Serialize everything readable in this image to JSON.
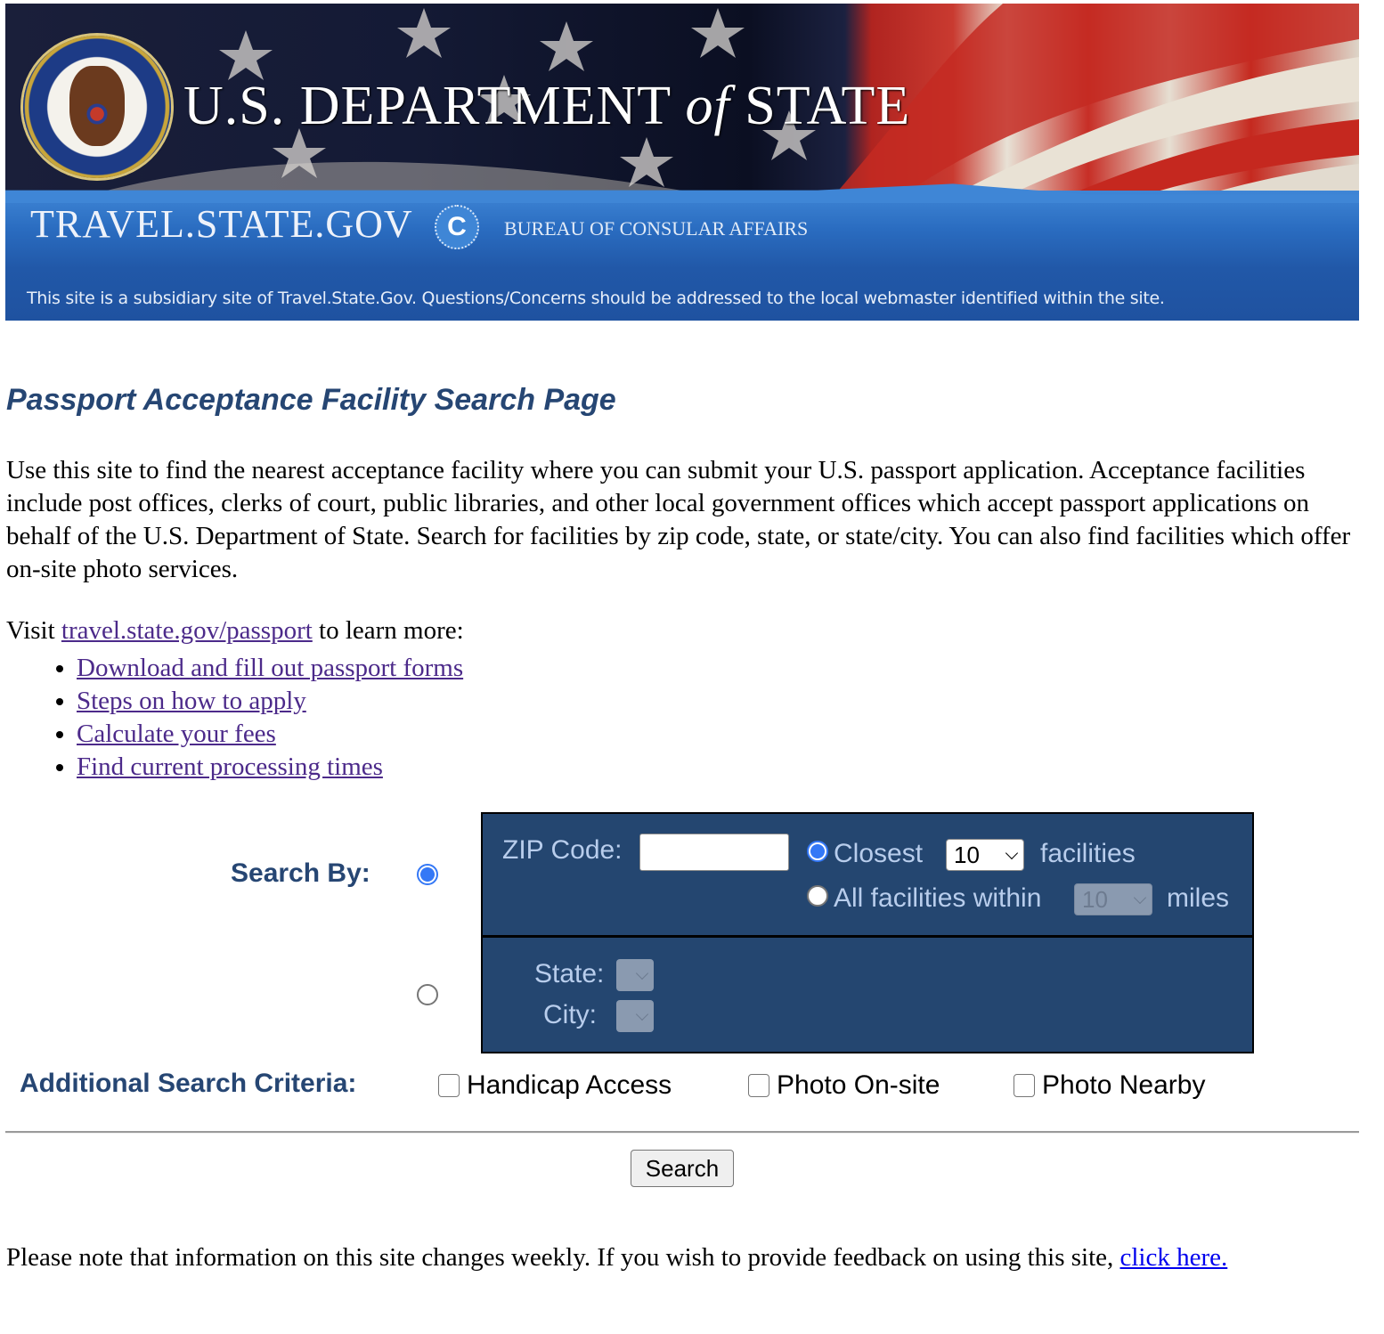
{
  "banner": {
    "department_prefix": "U.S. DEPARTMENT ",
    "department_of": "of",
    "department_suffix": " STATE",
    "site_name": "TRAVEL.STATE.GOV",
    "consular_logo_letter": "C",
    "bureau": "BUREAU OF CONSULAR AFFAIRS",
    "subsidiary_notice": "This site is a subsidiary site of Travel.State.Gov. Questions/Concerns should be addressed to the local webmaster identified within the site.",
    "seal_icon": "department-of-state-seal"
  },
  "page": {
    "title": "Passport Acceptance Facility Search Page",
    "intro": "Use this site to find the nearest acceptance facility where you can submit your U.S. passport application. Acceptance facilities include post offices, clerks of court, public libraries, and other local government offices which accept passport applications on behalf of the U.S. Department of State. Search for facilities by zip code, state, or state/city. You can also find facilities which offer on-site photo services.",
    "visit_prefix": "Visit ",
    "visit_link": "travel.state.gov/passport",
    "visit_suffix": " to learn more:",
    "links": [
      "Download and fill out passport forms",
      "Steps on how to apply",
      "Calculate your fees",
      "Find current processing times"
    ]
  },
  "search": {
    "search_by_label": "Search By:",
    "mode_selected": "zip",
    "zip": {
      "label": "ZIP Code:",
      "value": "",
      "closest_label": "Closest",
      "closest_selected": true,
      "closest_count": "10",
      "facilities_label": "facilities",
      "all_within_label": "All facilities within",
      "all_within_selected": false,
      "miles_value": "10",
      "miles_label": "miles"
    },
    "state_city": {
      "state_label": "State:",
      "state_value": "",
      "city_label": "City:",
      "city_value": ""
    },
    "additional_label": "Additional Search Criteria:",
    "criteria": [
      {
        "label": "Handicap Access",
        "checked": false
      },
      {
        "label": "Photo On-site",
        "checked": false
      },
      {
        "label": "Photo Nearby",
        "checked": false
      }
    ],
    "submit_label": "Search"
  },
  "footer": {
    "note": "Please note that information on this site changes weekly. If you wish to provide feedback on using this site, ",
    "link": "click here."
  },
  "colors": {
    "heading_blue": "#264673",
    "panel_blue": "#244670",
    "panel_text": "#b8cdec",
    "visited_link": "#4c2a8a",
    "link": "#0000ee",
    "radio_accent": "#3478f6"
  }
}
